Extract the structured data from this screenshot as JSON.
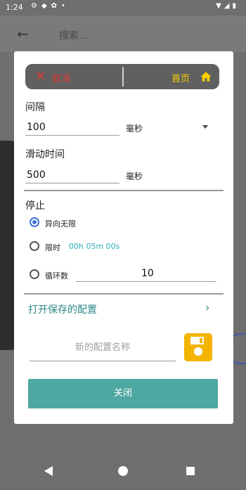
{
  "status_bar": {
    "time": "1:24"
  },
  "background": {
    "search_placeholder": "搜索..."
  },
  "dialog": {
    "topbar": {
      "cancel_label": "取消",
      "home_label": "首页"
    },
    "interval": {
      "label": "间隔",
      "value": "100",
      "unit": "毫秒"
    },
    "swipe_time": {
      "label": "滑动时间",
      "value": "500",
      "unit": "毫秒"
    },
    "stop": {
      "label": "停止",
      "options": [
        {
          "label": "异向无限",
          "selected": true
        },
        {
          "label": "限时",
          "value": "00h 05m 00s",
          "selected": false
        },
        {
          "label": "循环数",
          "value": "10",
          "selected": false
        }
      ]
    },
    "open_saved_config": "打开保存的配置",
    "new_config_name_placeholder": "新的配置名称",
    "close_label": "关闭"
  },
  "colors": {
    "teal": "#4fa7a3",
    "cancel_red": "#e53935",
    "home_yellow": "#f9d000",
    "save_yellow": "#f4b400",
    "radio_blue": "#3b72d9"
  }
}
